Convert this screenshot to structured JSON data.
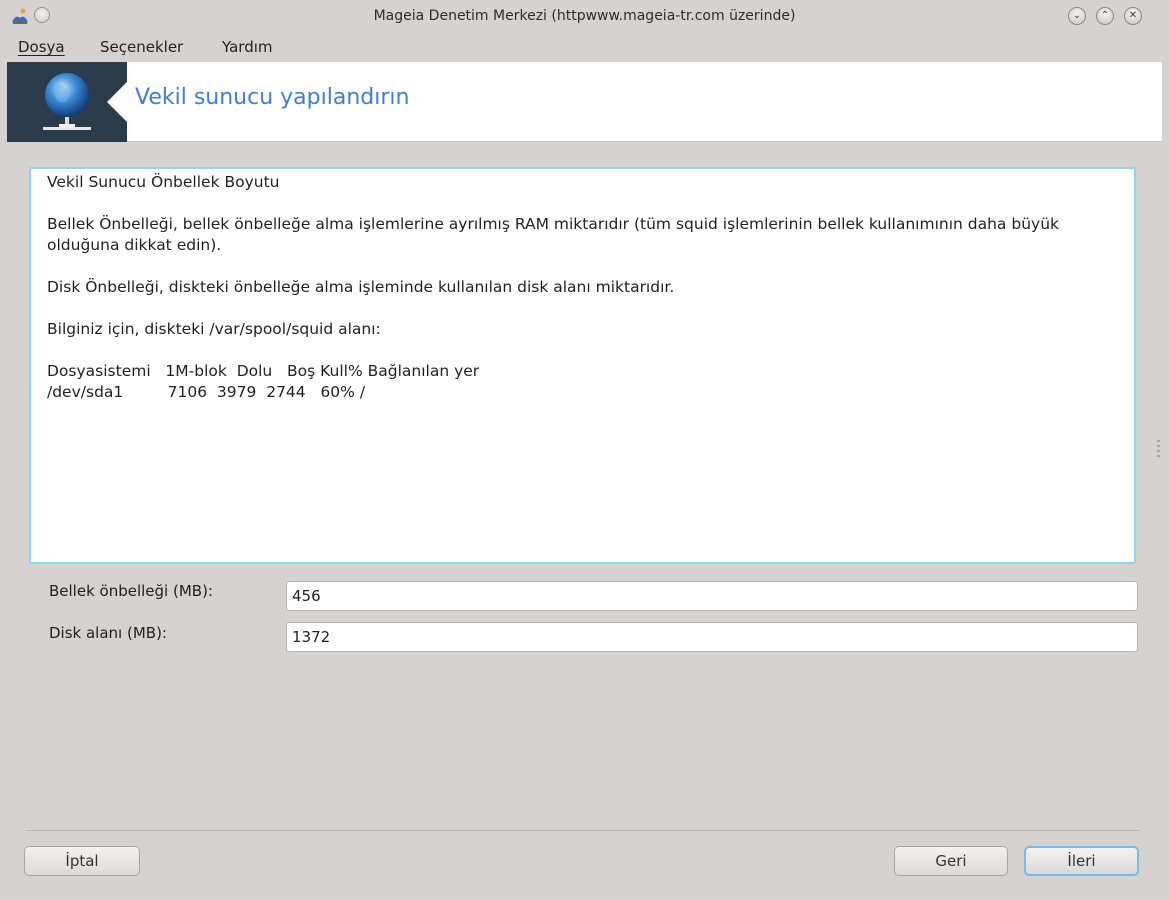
{
  "window": {
    "title": "Mageia Denetim Merkezi  (httpwww.mageia-tr.com üzerinde)",
    "controls": [
      "minimize",
      "maximize",
      "close"
    ]
  },
  "menubar": {
    "items": [
      {
        "label": "Dosya",
        "mnemonic": "D"
      },
      {
        "label": "Seçenekler",
        "mnemonic": "S"
      },
      {
        "label": "Yardım",
        "mnemonic": "Y"
      }
    ]
  },
  "banner": {
    "title": "Vekil sunucu yapılandırın",
    "icon": "network-globe-icon",
    "accent_color": "#3e7fce"
  },
  "info": {
    "heading": "Vekil Sunucu Önbellek Boyutu",
    "para1": "Bellek Önbelleği, bellek önbelleğe alma işlemlerine ayrılmış RAM miktarıdır (tüm squid işlemlerinin bellek kullanımının daha büyük olduğuna dikkat edin).",
    "para2": "Disk Önbelleği, diskteki önbelleğe alma işleminde kullanılan disk alanı miktarıdır.",
    "para3": "Bilginiz için, diskteki /var/spool/squid alanı:",
    "table_header": "Dosyasistemi   1M-blok  Dolu   Boş Kull% Bağlanılan yer",
    "table_row": "/dev/sda1         7106  3979  2744   60% /"
  },
  "form": {
    "memory_label": "Bellek önbelleği (MB):",
    "memory_value": "456",
    "disk_label": "Disk alanı (MB):",
    "disk_value": "1372"
  },
  "buttons": {
    "cancel": "İptal",
    "back": "Geri",
    "next": "İleri"
  }
}
